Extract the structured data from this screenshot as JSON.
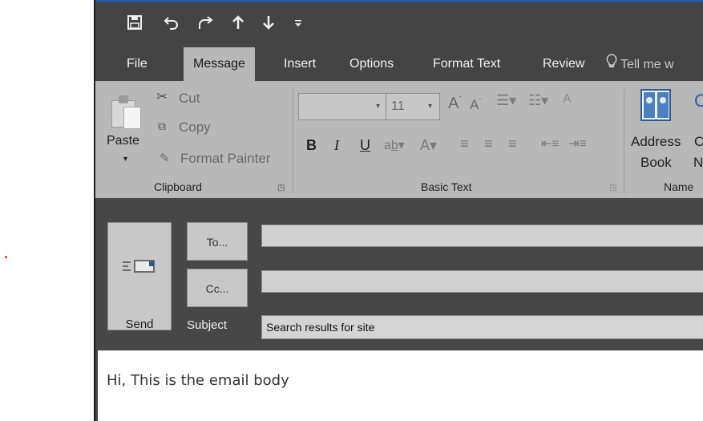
{
  "quick_access": {
    "save_icon": "save-icon",
    "undo_icon": "undo-icon",
    "redo_icon": "redo-icon",
    "up_icon": "arrow-up-icon",
    "down_icon": "arrow-down-icon",
    "customize_icon": "customize-qat-icon"
  },
  "tabs": {
    "file": "File",
    "message": "Message",
    "insert": "Insert",
    "options": "Options",
    "format_text": "Format Text",
    "review": "Review",
    "tell_me": "Tell me w"
  },
  "ribbon": {
    "clipboard": {
      "paste": "Paste",
      "cut": "Cut",
      "copy": "Copy",
      "format_painter": "Format Painter",
      "label": "Clipboard"
    },
    "basic_text": {
      "font_name": "",
      "font_size": "11",
      "bold": "B",
      "italic": "I",
      "underline": "U",
      "label": "Basic Text"
    },
    "names": {
      "address_book_line1": "Address",
      "address_book_line2": "Book",
      "check_names_line1": "C",
      "check_names_line2": "N",
      "label": "Name"
    }
  },
  "compose": {
    "send": "Send",
    "to_button": "To...",
    "cc_button": "Cc...",
    "to_value": "",
    "cc_value": "",
    "subject_label": "Subject",
    "subject_value": "Search results for site",
    "body": "Hi, This is the email body"
  },
  "colors": {
    "titlebar_accent": "#2c5aa0",
    "dark_chrome": "#444444",
    "ribbon": "#b8b8b8"
  }
}
